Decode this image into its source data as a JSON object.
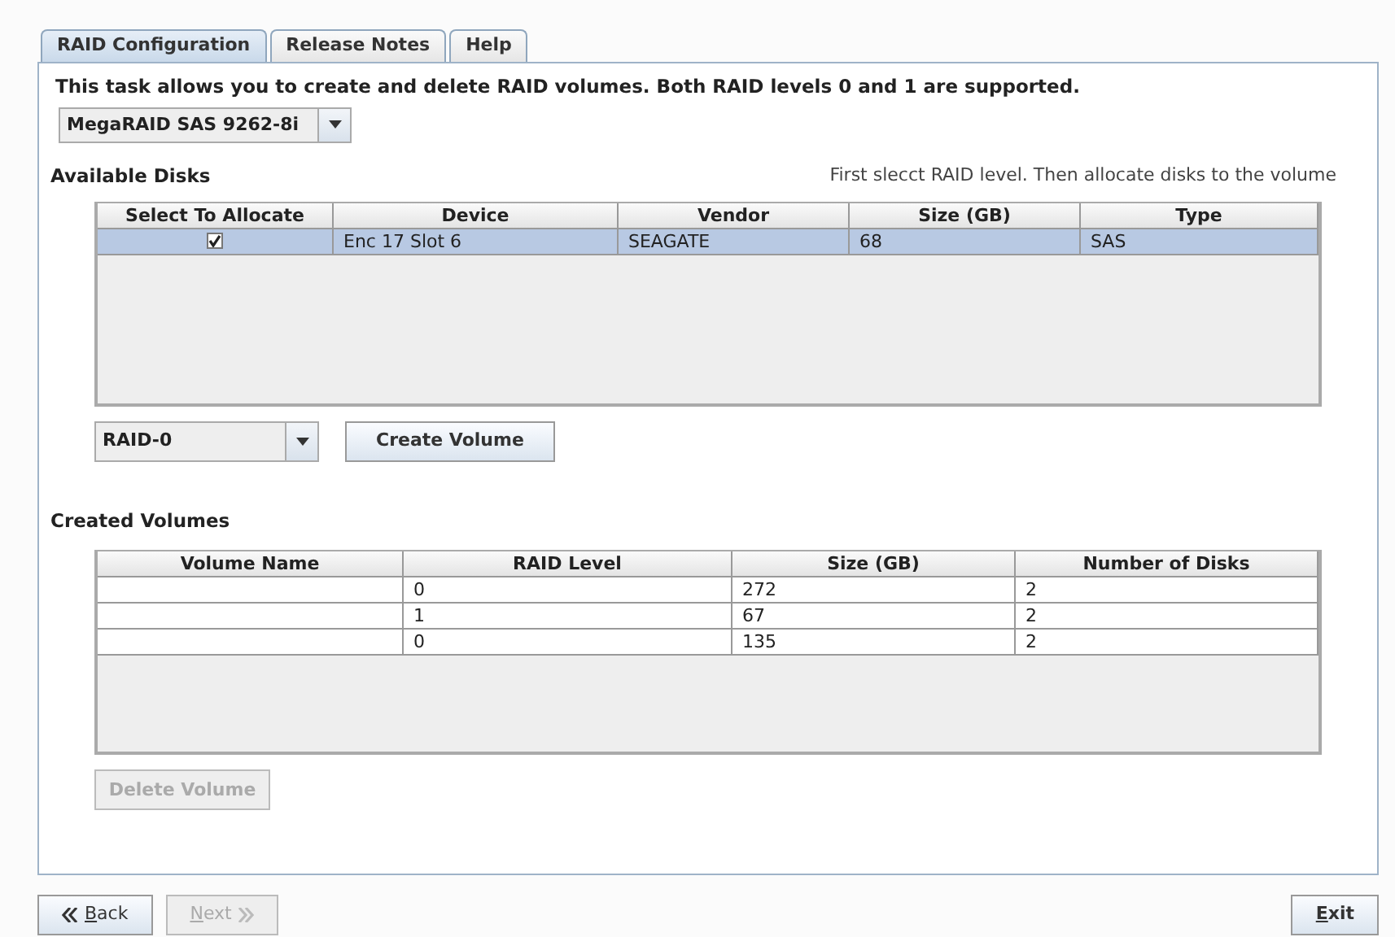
{
  "tabs": [
    {
      "label": "RAID Configuration",
      "selected": true
    },
    {
      "label": "Release Notes",
      "selected": false
    },
    {
      "label": "Help",
      "selected": false
    }
  ],
  "description": "This task allows you to create and delete RAID volumes. Both RAID levels 0 and 1 are supported.",
  "controller_select": {
    "value": "MegaRAID SAS 9262-8i"
  },
  "available_disks": {
    "title": "Available Disks",
    "hint": "First slecct RAID level. Then allocate disks to the volume",
    "columns": [
      "Select To Allocate",
      "Device",
      "Vendor",
      "Size (GB)",
      "Type"
    ],
    "rows": [
      {
        "checked": true,
        "selected": true,
        "cells": [
          "Enc 17 Slot 6",
          "SEAGATE",
          "68",
          "SAS"
        ]
      }
    ]
  },
  "raid_level_select": {
    "value": "RAID-0"
  },
  "create_button": {
    "label": "Create Volume",
    "disabled": false
  },
  "created_volumes": {
    "title": "Created Volumes",
    "columns": [
      "Volume Name",
      "RAID Level",
      "Size (GB)",
      "Number of Disks"
    ],
    "rows": [
      {
        "cells": [
          "",
          "0",
          "272",
          "2"
        ]
      },
      {
        "cells": [
          "",
          "1",
          "67",
          "2"
        ]
      },
      {
        "cells": [
          "",
          "0",
          "135",
          "2"
        ]
      }
    ]
  },
  "delete_button": {
    "label": "Delete Volume",
    "disabled": true
  },
  "nav_buttons": [
    {
      "kind": "back",
      "label": "Back",
      "disabled": false
    },
    {
      "kind": "next",
      "label": "Next",
      "disabled": true
    },
    {
      "kind": "exit",
      "label": "Exit",
      "disabled": false
    }
  ]
}
